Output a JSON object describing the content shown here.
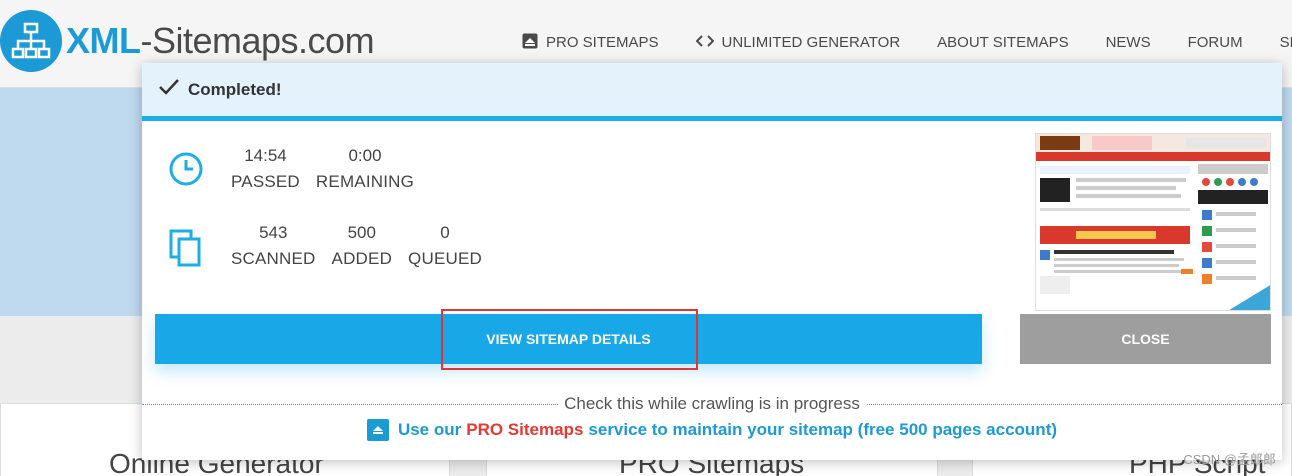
{
  "site": {
    "logo_text_a": "XML",
    "logo_text_b": "-Sitemaps.com",
    "nav": [
      {
        "label": "PRO SITEMAPS",
        "icon": "upload-box-icon"
      },
      {
        "label": "UNLIMITED GENERATOR",
        "icon": "code-icon"
      },
      {
        "label": "ABOUT SITEMAPS"
      },
      {
        "label": "NEWS"
      },
      {
        "label": "FORUM"
      },
      {
        "label": "SEO T"
      }
    ],
    "cards": [
      "Online Generator",
      "PRO Sitemaps",
      "PHP Script"
    ]
  },
  "modal": {
    "status": "Completed!",
    "time_stats": [
      {
        "value": "14:54",
        "label": "PASSED"
      },
      {
        "value": "0:00",
        "label": "REMAINING"
      }
    ],
    "page_stats": [
      {
        "value": "543",
        "label": "SCANNED"
      },
      {
        "value": "500",
        "label": "ADDED"
      },
      {
        "value": "0",
        "label": "QUEUED"
      }
    ],
    "view_button": "VIEW SITEMAP DETAILS",
    "close_button": "CLOSE",
    "progress_note": "Check this while crawling is in progress",
    "promo_prefix": "Use our",
    "promo_highlight": "PRO Sitemaps",
    "promo_suffix": "service to maintain your sitemap (free 500 pages account)"
  },
  "watermark": "CSDN @孟郎郎",
  "colors": {
    "accent": "#18a8e8",
    "brand": "#1c9ad6",
    "promo_red": "#e53935",
    "close_gray": "#9e9e9e"
  }
}
